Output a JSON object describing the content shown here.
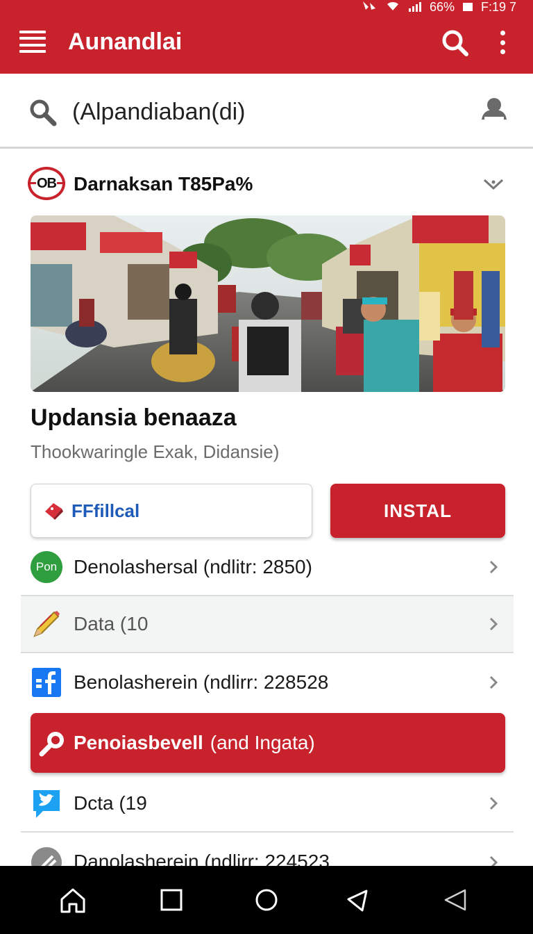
{
  "status_bar": {
    "battery": "66%",
    "time": "F:19 7"
  },
  "app_bar": {
    "title": "Aunandlai"
  },
  "search": {
    "value": "(Alpandiaban(di)"
  },
  "card": {
    "logo_text": "OB",
    "title": "Darnaksan T85Pa%",
    "headline": "Updansia benaaza",
    "subline": "Thookwaringle Exak, Didansie)",
    "secondary_button": "FFfillcal",
    "primary_button": "INSTAL"
  },
  "list": {
    "items": [
      {
        "icon": "pon-badge-icon",
        "badge": "Pon",
        "label": "Denolashersal (ndlitr: 2850)"
      },
      {
        "icon": "pencil-icon",
        "label": "Data (10"
      },
      {
        "icon": "facebook-icon",
        "label": "Benolasherein (ndlirr: 228528"
      },
      {
        "icon": "twitter-bird-icon",
        "label": "Dcta (19"
      },
      {
        "icon": "link-icon",
        "label": "Danolasherein (ndlirr: 224523"
      }
    ],
    "banner": {
      "icon": "search-icon",
      "main": "Penoiasbevell",
      "sub": "(and Ingata)"
    }
  },
  "nav_bar": {
    "items": [
      "home-icon",
      "square-icon",
      "circle-icon",
      "back-triangle-icon",
      "back-triangle-outline-icon"
    ]
  },
  "colors": {
    "primary": "#c8232c",
    "link": "#1e5bb8",
    "twitter": "#1da1f2",
    "facebook": "#1877f2",
    "pon": "#2e9e3e"
  }
}
